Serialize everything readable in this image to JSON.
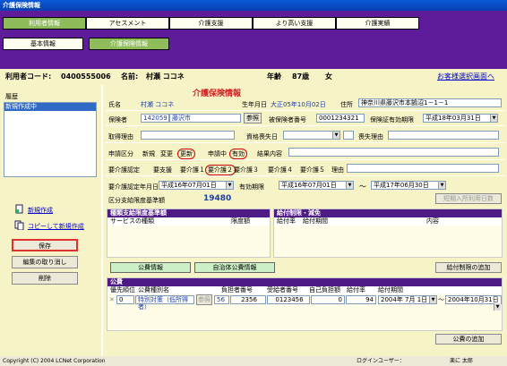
{
  "window_title": "介護保険情報",
  "tabs": [
    "利用者情報",
    "アセスメント",
    "介護支援",
    "より高い支援",
    "介護実績"
  ],
  "subtabs": [
    "基本情報",
    "介護保険情報"
  ],
  "infobar": {
    "user_code_label": "利用者コード:",
    "user_code": "0400555006",
    "name_label": "名前:",
    "name": "村瀬 ココネ",
    "age_label": "年齢",
    "age": "87歳",
    "gender": "女",
    "back_link": "お客様選択画面へ"
  },
  "left": {
    "history_label": "履歴",
    "history_items": [
      "新規作成中"
    ],
    "new_link": "新規作成",
    "copy_link": "コピーして新規作成",
    "save_btn": "保存",
    "cancel_btn": "編集の取り消し",
    "delete_btn": "削除"
  },
  "form": {
    "heading": "介護保険情報",
    "name_label": "氏名",
    "name_value": "村瀬 ココネ",
    "birth_label": "生年月日",
    "birth_value": "大正05年10月02日",
    "address_label": "住所",
    "address_value": "神奈川県藤沢市本鵠沼1－1－1",
    "insurer_label": "保険者",
    "insurer_code": "142059",
    "insurer_city": "藤沢市",
    "ref_btn": "参照",
    "insured_no_label": "被保険者番号",
    "insured_no": "0001234321",
    "cert_label": "保険証有効期限",
    "cert_value": "平成18年03月31日",
    "acq_label": "取得理由",
    "qual_lost_label": "資格喪失日",
    "lost_reason_label": "喪失理由",
    "apply_label": "申請区分",
    "apply_new": "新規",
    "apply_change": "変更",
    "apply_renew": "更新",
    "applying_label": "申請中",
    "applying_value": "有効",
    "result_label": "結果内容",
    "care_label": "要介護認定",
    "care_opts": [
      "要支援",
      "要介護１",
      "要介護２",
      "要介護３",
      "要介護４",
      "要介護５"
    ],
    "reason_label": "理由",
    "care_date_label": "要介護認定年月日",
    "care_date": "平成16年07月01日",
    "valid_label": "有効期限",
    "valid_from": "平成16年07月01日",
    "valid_to": "平成17年06月30日",
    "tilde": "～",
    "limit_label": "区分支給限度基準額",
    "limit_value": "19480",
    "short_stay_btn": "短期入所利用日数",
    "svc_section": "種類支給限度基準額",
    "svc_cols": [
      "サービスの種類",
      "限度額"
    ],
    "benefit_section": "給付制限・減免",
    "benefit_cols": [
      "給付率",
      "給付期間",
      "内容"
    ],
    "public_btn": "公費情報",
    "local_btn": "自治体公費情報",
    "add_benefit_btn": "給付制限の追加",
    "public_section": "公費",
    "public_cols": [
      "優先順位",
      "公費種別名",
      "負担者番号",
      "受給者番号",
      "自己負担額",
      "給付率",
      "給付期間"
    ],
    "public_row": {
      "priority": "0",
      "type": "特別対策（低所得者）",
      "ref": "参照",
      "code": "56",
      "burden_no": "2356",
      "recipient_no": "0123456",
      "self_pay": "0",
      "rate": "94",
      "from": "2004年 7月 1日",
      "to": "2004年10月31日"
    },
    "add_public_btn": "公費の追加"
  },
  "status": {
    "copyright": "Copyright (C) 2004 LCNet Corporation",
    "login_label": "ログインユーザー：",
    "login_user": "楽に 太郎"
  },
  "colors": {
    "topband": "#5e1c9a",
    "panel": "#f6f3c6",
    "selected_tab": "#8fbc5a"
  }
}
